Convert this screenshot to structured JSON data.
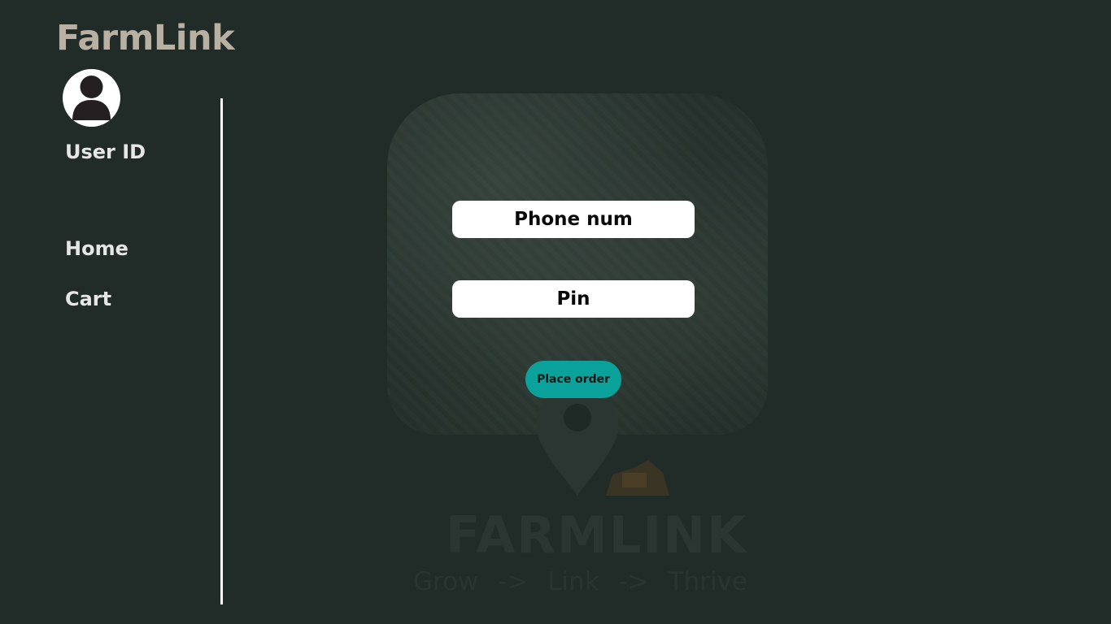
{
  "app": {
    "brand": "FarmLink"
  },
  "sidebar": {
    "user_id_label": "User ID",
    "avatar_icon": "user-avatar-icon",
    "items": [
      {
        "label": "Home"
      },
      {
        "label": "Cart"
      }
    ]
  },
  "form": {
    "phone_placeholder": "Phone num",
    "pin_placeholder": "Pin",
    "submit_label": "Place order"
  },
  "watermark": {
    "title": "FARMLINK",
    "tagline": "Grow  ->  Link  ->  Thrive"
  },
  "colors": {
    "background": "#212b28",
    "brand_text": "#b9b0a4",
    "accent": "#0aa29a",
    "field_bg": "#ffffff"
  }
}
